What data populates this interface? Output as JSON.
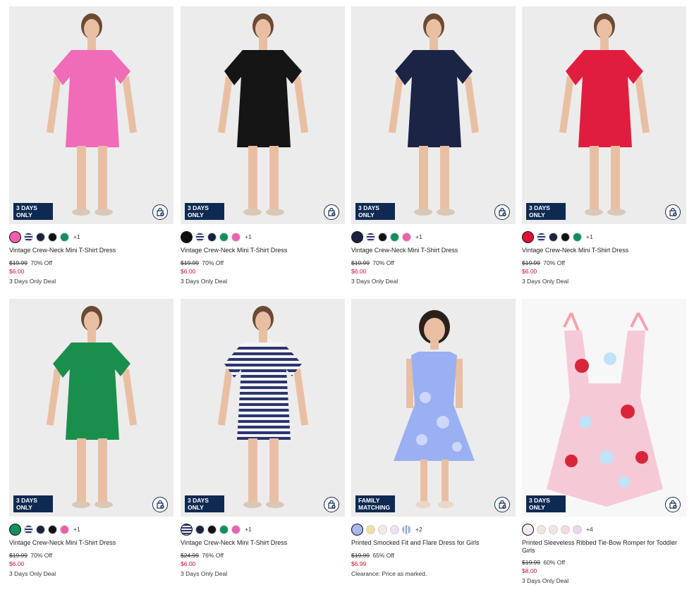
{
  "products": [
    {
      "name": "Vintage Crew-Neck Mini T-Shirt Dress",
      "badge": "3 DAYS ONLY",
      "original_price": "$19.99",
      "discount": "70% Off",
      "sale_price": "$6.00",
      "note": "3 Days Only Deal",
      "more_colors": "+1",
      "swatches": [
        "#ee5fae",
        "stripe-navy",
        "#1b2340",
        "#111111",
        "#11905a"
      ],
      "selected_swatch": 0,
      "dress_color": "#f06bb8",
      "icon": "shopping-bag-icon"
    },
    {
      "name": "Vintage Crew-Neck Mini T-Shirt Dress",
      "badge": "3 DAYS ONLY",
      "original_price": "$19.99",
      "discount": "70% Off",
      "sale_price": "$6.00",
      "note": "3 Days Only Deal",
      "more_colors": "+1",
      "swatches": [
        "#111111",
        "stripe-navy",
        "#1b2340",
        "#11905a",
        "#ee5fae"
      ],
      "selected_swatch": 0,
      "dress_color": "#151515",
      "icon": "shopping-bag-icon"
    },
    {
      "name": "Vintage Crew-Neck Mini T-Shirt Dress",
      "badge": "3 DAYS ONLY",
      "original_price": "$19.99",
      "discount": "70% Off",
      "sale_price": "$6.00",
      "note": "3 Days Only Deal",
      "more_colors": "+1",
      "swatches": [
        "#1b2340",
        "stripe-navy",
        "#111111",
        "#11905a",
        "#ee5fae"
      ],
      "selected_swatch": 0,
      "dress_color": "#1c2445",
      "icon": "shopping-bag-icon"
    },
    {
      "name": "Vintage Crew-Neck Mini T-Shirt Dress",
      "badge": "3 DAYS ONLY",
      "original_price": "$19.99",
      "discount": "70% Off",
      "sale_price": "$6.00",
      "note": "3 Days Only Deal",
      "more_colors": "+1",
      "swatches": [
        "#e0123a",
        "stripe-navy",
        "#1b2340",
        "#111111",
        "#11905a"
      ],
      "selected_swatch": 0,
      "dress_color": "#e11d3f",
      "icon": "shopping-bag-icon"
    },
    {
      "name": "Vintage Crew-Neck Mini T-Shirt Dress",
      "badge": "3 DAYS ONLY",
      "original_price": "$19.99",
      "discount": "70% Off",
      "sale_price": "$6.00",
      "note": "3 Days Only Deal",
      "more_colors": "+1",
      "swatches": [
        "#11905a",
        "stripe-navy",
        "#1b2340",
        "#111111",
        "#ee5fae"
      ],
      "selected_swatch": 0,
      "dress_color": "#1a8f4c",
      "icon": "shopping-bag-icon"
    },
    {
      "name": "Vintage Crew-Neck Mini T-Shirt Dress",
      "badge": "3 DAYS ONLY",
      "original_price": "$24.99",
      "discount": "76% Off",
      "sale_price": "$6.00",
      "note": "3 Days Only Deal",
      "more_colors": "+1",
      "swatches": [
        "stripe-navy",
        "#1b2340",
        "#111111",
        "#11905a",
        "#ee5fae"
      ],
      "selected_swatch": 0,
      "dress_color": "stripe",
      "icon": "shopping-bag-icon"
    },
    {
      "name": "Printed Smocked Fit and Flare Dress for Girls",
      "badge": "FAMILY MATCHING",
      "original_price": "$19.99",
      "discount": "65% Off",
      "sale_price": "$6.99",
      "note": "Clearance: Price as marked.",
      "more_colors": "+2",
      "swatches": [
        "#a9b8f0",
        "#f3dda0",
        "#f6e6ec",
        "#efe0f5",
        "stripe-blue"
      ],
      "selected_swatch": 0,
      "dress_color": "#9bb0f2",
      "icon": "shopping-bag-icon"
    },
    {
      "name": "Printed Sleeveless Ribbed Tie-Bow Romper for Toddler Girls",
      "badge": "3 DAYS ONLY",
      "original_price": "$19.99",
      "discount": "60% Off",
      "sale_price": "$8.00",
      "note": "3 Days Only Deal",
      "more_colors": "+4",
      "swatches": [
        "#f7e9f3",
        "#f2e6d6",
        "#f8e3e3",
        "#f6d8dc",
        "#ead7ef"
      ],
      "selected_swatch": 0,
      "dress_color": "romper",
      "icon": "shopping-bag-icon"
    }
  ]
}
